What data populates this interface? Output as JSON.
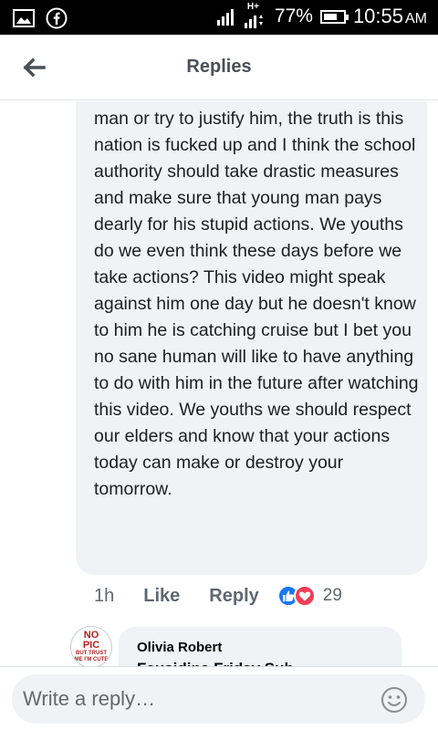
{
  "status_bar": {
    "network_type": "H+",
    "battery": "77%",
    "time": "10:55",
    "ampm": "AM"
  },
  "header": {
    "title": "Replies"
  },
  "comment": {
    "text": "that some people will support the young man or try to justify him, the truth is this nation is fucked up and I think the school authority should take drastic measures and make sure that young man pays dearly for his stupid actions. We youths do we even think these days before we take actions? This video might speak against him one day but he doesn't know to him he is catching cruise but I bet you no sane human will like to have anything to do with him in the future after watching this video. We youths we should respect our elders and know that your actions today can make or destroy your tomorrow.",
    "time": "1h",
    "like_label": "Like",
    "reply_label": "Reply",
    "reaction_count": "29"
  },
  "reply": {
    "avatar_text": {
      "line1": "NO",
      "line2": "PIC",
      "line3": "BUT TRUST ME I'M CUTE"
    },
    "author": "Olivia Robert",
    "text": "Fausidina Friday Sub"
  },
  "composer": {
    "placeholder": "Write a reply…"
  },
  "colors": {
    "accent": "#1877f2",
    "love": "#f33e58",
    "bubble": "#f0f2f5"
  }
}
